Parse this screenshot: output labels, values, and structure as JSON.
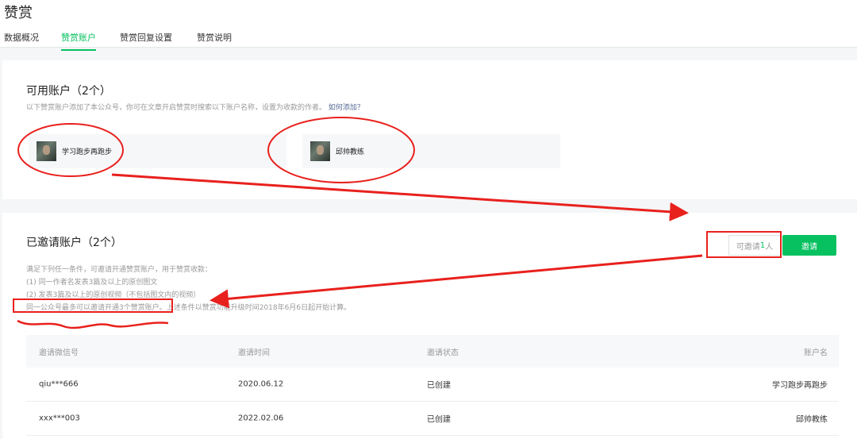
{
  "header": {
    "title": "赞赏",
    "tabs": [
      {
        "label": "数据概况"
      },
      {
        "label": "赞赏账户"
      },
      {
        "label": "赞赏回复设置"
      },
      {
        "label": "赞赏说明"
      }
    ],
    "active_tab": "赞赏账户"
  },
  "available": {
    "title": "可用账户（2个）",
    "desc": "以下赞赏账户添加了本公众号，你可在文章开启赞赏时搜索以下账户名称，设置为收款的作者。",
    "link": "如何添加？",
    "accounts": [
      {
        "name": "学习跑步再跑步"
      },
      {
        "name": "邱帅教练"
      }
    ]
  },
  "invited": {
    "title": "已邀请账户（2个）",
    "invite_prefix": "可邀请",
    "invite_count": "1",
    "invite_suffix": "人",
    "invite_button": "邀请",
    "rules": [
      "满足下列任一条件，可邀请开通赞赏账户，用于赞赏收款：",
      "(1) 同一作者名发表3篇及以上的原创图文",
      "(2) 发表3篇及以上的原创视频（不包括图文内的视频）",
      "同一公众号最多可以邀请开通3个赞赏账户。上述条件以赞赏功能升级时间2018年6月6日起开始计算。"
    ],
    "table": {
      "headers": [
        "邀请微信号",
        "邀请时间",
        "邀请状态",
        "账户名"
      ],
      "rows": [
        [
          "qiu***666",
          "2020.06.12",
          "已创建",
          "学习跑步再跑步"
        ],
        [
          "xxx***003",
          "2022.02.06",
          "已创建",
          "邱帅教练"
        ]
      ]
    }
  },
  "colors": {
    "accent": "#07c160",
    "annotation": "#e8211d",
    "link": "#576b95"
  }
}
